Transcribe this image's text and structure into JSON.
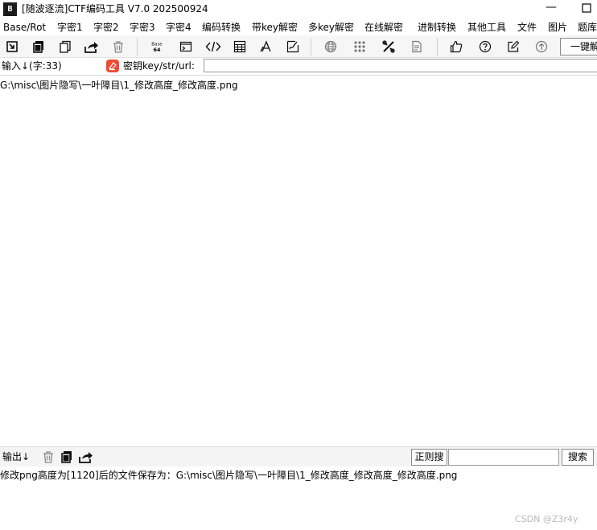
{
  "window": {
    "title": "[随波逐流]CTF编码工具 V7.0  202500924",
    "app_icon_text": "B",
    "min_symbol": "—"
  },
  "menu": [
    "Base/Rot",
    "字密1",
    "字密2",
    "字密3",
    "字密4",
    "编码转换",
    "带key解密",
    "多key解密",
    "在线解密",
    "进制转换",
    "其他工具",
    "文件",
    "图片",
    "题库"
  ],
  "toolbar": {
    "icons": [
      "import-icon",
      "copy-stack-icon",
      "paste-icon",
      "share-icon",
      "trash-icon",
      "base64-icon",
      "terminal-icon",
      "code-icon",
      "calculator-icon",
      "font-icon",
      "signature-icon",
      "globe-icon",
      "grid-icon",
      "tools-icon",
      "document-icon",
      "thumbs-up-icon",
      "help-icon",
      "edit-icon",
      "upload-icon"
    ],
    "base64_top": "Base",
    "base64_bottom": "64",
    "onekey_label": "一键解"
  },
  "input": {
    "label": "输入↓(字:33)",
    "key_label": "密钥key/str/url:",
    "key_value": "",
    "content": "G:\\misc\\图片隐写\\一叶障目\\1_修改高度_修改高度.png"
  },
  "output": {
    "label": "输出↓",
    "regex_button": "正则搜",
    "search_value": "",
    "search_button": "搜索",
    "content": "修改png高度为[1120]后的文件保存为：G:\\misc\\图片隐写\\一叶障目\\1_修改高度_修改高度_修改高度.png"
  },
  "watermark": "CSDN @Z3r4y",
  "colors": {
    "key_icon": "#ef4b32",
    "toolbar_bg": "#f6f6f6"
  }
}
